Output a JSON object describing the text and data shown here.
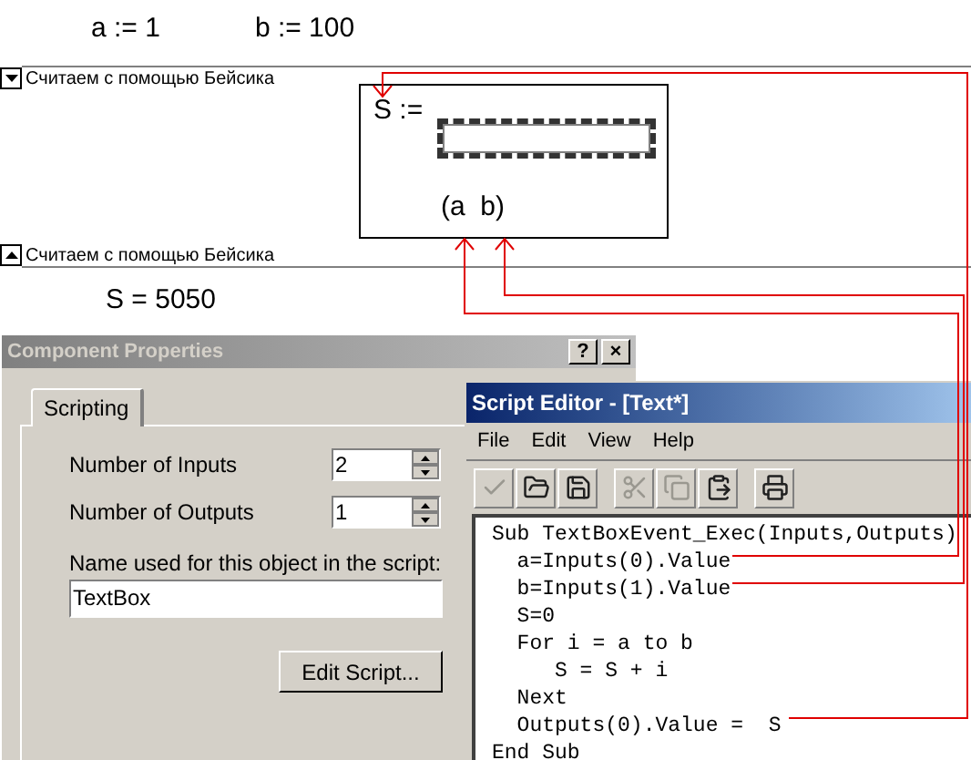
{
  "worksheet": {
    "definitions": [
      "a := 1",
      "b := 100"
    ],
    "region_markers": [
      {
        "kind": "start",
        "title": "Считаем с помощью Бейсика"
      },
      {
        "kind": "end",
        "title": "Считаем с помощью Бейсика"
      }
    ],
    "component": {
      "label": "S :=",
      "selected": true,
      "inputs": "(a  b)"
    },
    "result": "S = 5050"
  },
  "component_properties": {
    "title": "Component Properties",
    "title_buttons": [
      "?",
      "×"
    ],
    "tabs": [
      {
        "label": "Scripting",
        "selected": true
      }
    ],
    "inputs_label": "Number of Inputs",
    "inputs_value": "2",
    "outputs_label": "Number of Outputs",
    "outputs_value": "1",
    "name_label": "Name used for this object in the script:",
    "name_value": "TextBox",
    "edit_button": "Edit Script..."
  },
  "script_editor": {
    "title": "Script Editor - [Text*]",
    "menu": [
      "File",
      "Edit",
      "View",
      "Help"
    ],
    "toolbar": [
      {
        "kind": "check",
        "disabled": true
      },
      {
        "kind": "open",
        "disabled": false
      },
      {
        "kind": "save",
        "disabled": false
      },
      {
        "kind": "cut",
        "disabled": true
      },
      {
        "kind": "copy",
        "disabled": true
      },
      {
        "kind": "paste",
        "disabled": false
      },
      {
        "kind": "print",
        "disabled": false
      }
    ],
    "code": [
      "Sub TextBoxEvent_Exec(Inputs,Outputs)",
      "  a=Inputs(0).Value",
      "  b=Inputs(1).Value",
      "  S=0",
      "  For i = a to b",
      "     S = S + i",
      "  Next",
      "  Outputs(0).Value =  S",
      "End Sub"
    ]
  }
}
